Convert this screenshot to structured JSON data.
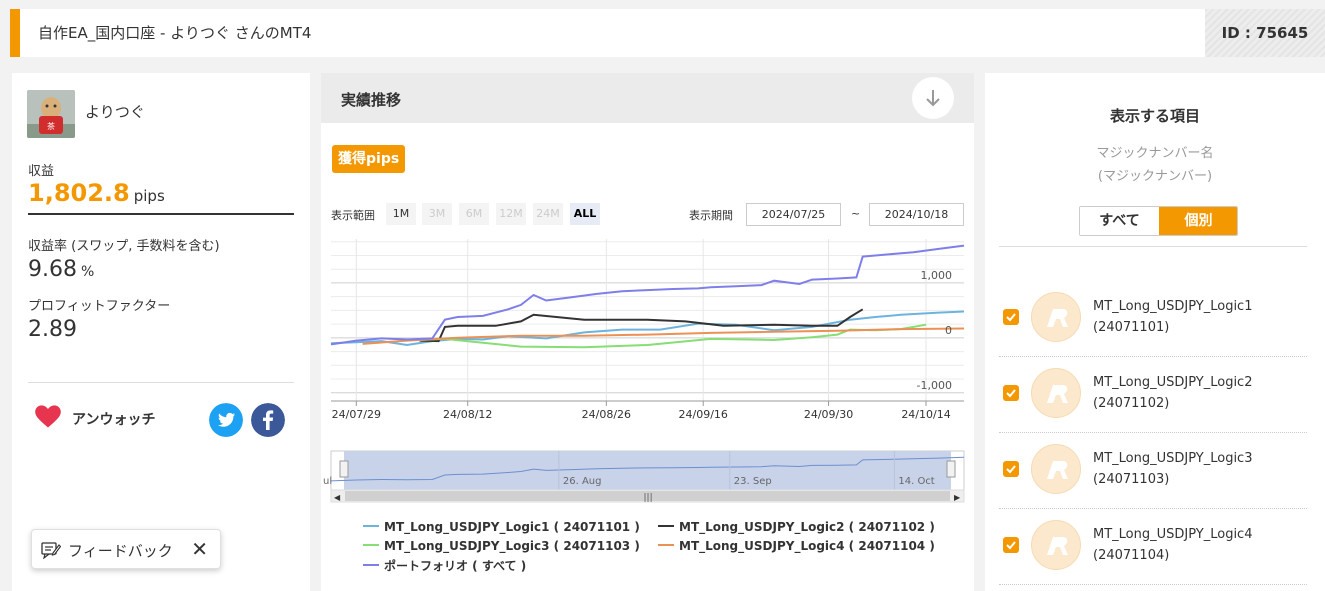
{
  "header": {
    "title": "自作EA_国内口座 - よりつぐ さんのMT4",
    "id_label": "ID : 75645"
  },
  "profile": {
    "username": "よりつぐ",
    "profit_label": "収益",
    "profit_value": "1,802.8",
    "profit_unit": "pips",
    "rate_label": "収益率 (スワップ, 手数料を含む)",
    "rate_value": "9.68",
    "rate_unit": "%",
    "pf_label": "プロフィットファクター",
    "pf_value": "2.89",
    "watch_label": "アンウォッチ"
  },
  "feedback": {
    "label": "フィードバック",
    "close": "✕"
  },
  "performance": {
    "title": "実績推移",
    "badge": "獲得pips",
    "range_label": "表示範囲",
    "range_buttons": [
      "1M",
      "3M",
      "6M",
      "12M",
      "24M",
      "ALL"
    ],
    "period_label": "表示期間",
    "date_from": "2024/07/25",
    "date_sep": "~",
    "date_to": "2024/10/18"
  },
  "chart_data": {
    "type": "line",
    "x_ticks": [
      "24/07/29",
      "24/08/12",
      "24/08/26",
      "24/09/16",
      "24/09/30",
      "24/10/14"
    ],
    "y_ticks": [
      "1,000",
      "0",
      "-1,000"
    ],
    "ylim": [
      -1150,
      1800
    ],
    "navigator_labels": [
      "ul",
      "26. Aug",
      "23. Sep",
      "14. Oct"
    ],
    "series": [
      {
        "name": "MT_Long_USDJPY_Logic1 ( 24071101 )",
        "color": "#6cb4dd",
        "points": [
          [
            0,
            -100
          ],
          [
            4,
            -80
          ],
          [
            8,
            -60
          ],
          [
            12,
            -130
          ],
          [
            16,
            -60
          ],
          [
            20,
            -20
          ],
          [
            24,
            -30
          ],
          [
            28,
            30
          ],
          [
            34,
            -10
          ],
          [
            40,
            100
          ],
          [
            46,
            150
          ],
          [
            52,
            150
          ],
          [
            58,
            260
          ],
          [
            64,
            240
          ],
          [
            70,
            140
          ],
          [
            76,
            200
          ],
          [
            82,
            330
          ],
          [
            86,
            380
          ],
          [
            90,
            420
          ],
          [
            96,
            460
          ],
          [
            100,
            480
          ]
        ]
      },
      {
        "name": "MT_Long_USDJPY_Logic2 ( 24071102 )",
        "color": "#333333",
        "points": [
          [
            14,
            -50
          ],
          [
            17,
            -60
          ],
          [
            18,
            200
          ],
          [
            20,
            220
          ],
          [
            26,
            220
          ],
          [
            30,
            300
          ],
          [
            32,
            420
          ],
          [
            40,
            330
          ],
          [
            50,
            330
          ],
          [
            56,
            300
          ],
          [
            62,
            220
          ],
          [
            70,
            240
          ],
          [
            76,
            220
          ],
          [
            80,
            220
          ],
          [
            82,
            380
          ],
          [
            84,
            520
          ]
        ]
      },
      {
        "name": "MT_Long_USDJPY_Logic3 ( 24071103 )",
        "color": "#86de74",
        "points": [
          [
            10,
            -20
          ],
          [
            14,
            -40
          ],
          [
            18,
            -20
          ],
          [
            24,
            -90
          ],
          [
            30,
            -160
          ],
          [
            40,
            -170
          ],
          [
            50,
            -130
          ],
          [
            60,
            -20
          ],
          [
            70,
            -40
          ],
          [
            76,
            10
          ],
          [
            80,
            60
          ],
          [
            82,
            150
          ],
          [
            86,
            140
          ],
          [
            90,
            160
          ],
          [
            94,
            240
          ]
        ]
      },
      {
        "name": "MT_Long_USDJPY_Logic4 ( 24071104 )",
        "color": "#ec9155",
        "points": [
          [
            5,
            -110
          ],
          [
            12,
            -50
          ],
          [
            20,
            0
          ],
          [
            30,
            40
          ],
          [
            40,
            40
          ],
          [
            50,
            60
          ],
          [
            60,
            90
          ],
          [
            70,
            110
          ],
          [
            80,
            130
          ],
          [
            90,
            160
          ],
          [
            100,
            170
          ]
        ]
      },
      {
        "name": "ポートフォリオ ( すべて )",
        "color": "#7f7fea",
        "points": [
          [
            0,
            -120
          ],
          [
            4,
            -50
          ],
          [
            8,
            -10
          ],
          [
            12,
            -30
          ],
          [
            16,
            -10
          ],
          [
            18,
            330
          ],
          [
            20,
            380
          ],
          [
            24,
            400
          ],
          [
            28,
            520
          ],
          [
            30,
            600
          ],
          [
            32,
            780
          ],
          [
            34,
            680
          ],
          [
            38,
            740
          ],
          [
            42,
            800
          ],
          [
            46,
            850
          ],
          [
            50,
            870
          ],
          [
            54,
            890
          ],
          [
            58,
            900
          ],
          [
            60,
            920
          ],
          [
            64,
            940
          ],
          [
            68,
            960
          ],
          [
            70,
            1040
          ],
          [
            74,
            980
          ],
          [
            76,
            1060
          ],
          [
            80,
            1080
          ],
          [
            83,
            1100
          ],
          [
            84,
            1480
          ],
          [
            88,
            1520
          ],
          [
            92,
            1560
          ],
          [
            96,
            1620
          ],
          [
            100,
            1680
          ]
        ]
      }
    ]
  },
  "legend_items": [
    "MT_Long_USDJPY_Logic1 ( 24071101 )",
    "MT_Long_USDJPY_Logic2 ( 24071102 )",
    "MT_Long_USDJPY_Logic3 ( 24071103 )",
    "MT_Long_USDJPY_Logic4 ( 24071104 )",
    "ポートフォリオ ( すべて )"
  ],
  "display_settings": {
    "title": "表示する項目",
    "sub_line1": "マジックナンバー名",
    "sub_line2": "(マジックナンバー)",
    "tab_all": "すべて",
    "tab_individual": "個別",
    "items": [
      {
        "name": "MT_Long_USDJPY_Logic1",
        "magic": "(24071101)"
      },
      {
        "name": "MT_Long_USDJPY_Logic2",
        "magic": "(24071102)"
      },
      {
        "name": "MT_Long_USDJPY_Logic3",
        "magic": "(24071103)"
      },
      {
        "name": "MT_Long_USDJPY_Logic4",
        "magic": "(24071104)"
      }
    ]
  },
  "colors": {
    "accent": "#f39800",
    "twitter": "#1da1f2",
    "facebook": "#3b5998",
    "heart": "#e7344f"
  },
  "icons": [
    "download-icon",
    "heart-icon",
    "twitter-icon",
    "facebook-icon",
    "feedback-icon",
    "close-icon",
    "checkbox-icon",
    "strategy-logo-icon"
  ]
}
